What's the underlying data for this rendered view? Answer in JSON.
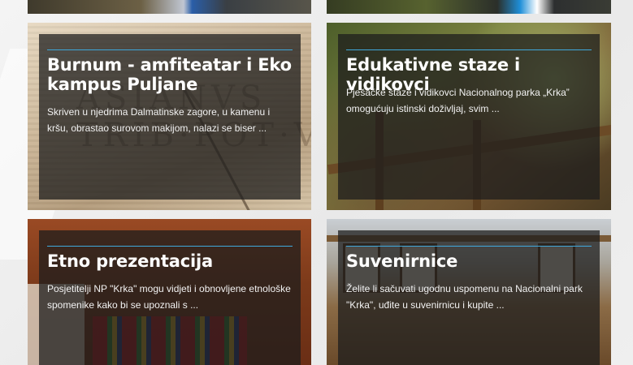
{
  "cards": [
    {
      "title": "Burnum - amfiteatar i Eko kampus Puljane",
      "excerpt": "Skriven u njedrima Dalmatinske zagore, u kamenu i kršu, obrastao surovom makijom, nalazi se biser ..."
    },
    {
      "title": "Edukativne staze i vidikovci",
      "excerpt": "Pješačke staze i vidikovci Nacionalnog parka „Krka” omogućuju istinski doživljaj, svim ..."
    },
    {
      "title": "Etno prezentacija",
      "excerpt": "Posjetitelji NP \"Krka\" mogu vidjeti i obnovljene etnološke spomenike kako bi se upoznali s ..."
    },
    {
      "title": "Suvenirnice",
      "excerpt": "Želite li sačuvati ugodnu uspomenu na Nacionalni park \"Krka\", uđite u suvenirnicu i kupite ..."
    }
  ],
  "colors": {
    "accent_line": "#3fa9dd",
    "overlay": "rgba(28,28,28,0.74)",
    "text": "#ffffff"
  }
}
